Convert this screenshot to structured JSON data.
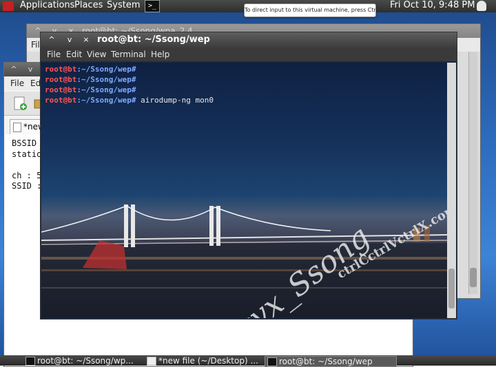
{
  "top_panel": {
    "menus": [
      "Applications",
      "Places",
      "System"
    ],
    "launcher_glyph": ">_",
    "clock": "Fri Oct 10,  9:48 PM",
    "tooltip": "To direct input to this virtual machine, press Ctrl+G."
  },
  "back_window": {
    "title": "root@bt: ~/Ssong/wpa_2.4",
    "menu_first": "File"
  },
  "editor_window": {
    "menus": [
      "File",
      "Ed"
    ],
    "tab_label": "*new",
    "lines": [
      "BSSID",
      "statio",
      "",
      "ch : 5",
      "SSID :"
    ]
  },
  "terminal": {
    "title": "root@bt: ~/Ssong/wep",
    "menus": [
      "File",
      "Edit",
      "View",
      "Terminal",
      "Help"
    ],
    "lines": [
      {
        "user": "root@bt",
        "path": ":~/Ssong/wep#",
        "cmd": ""
      },
      {
        "user": "root@bt",
        "path": ":~/Ssong/wep#",
        "cmd": ""
      },
      {
        "user": "root@bt",
        "path": ":~/Ssong/wep#",
        "cmd": ""
      },
      {
        "user": "root@bt",
        "path": ":~/Ssong/wep#",
        "cmd": " airodump-ng mon0"
      }
    ],
    "watermark_1": "cvx_Ssong",
    "watermark_2": "ctrlCctrlVctrlX.com"
  },
  "taskbar": {
    "tasks": [
      {
        "label": "root@bt: ~/Ssong/wp...",
        "active": false
      },
      {
        "label": "*new file (~/Desktop) ...",
        "active": false
      },
      {
        "label": "root@bt: ~/Ssong/wep",
        "active": true
      }
    ]
  },
  "colors": {
    "prompt_user": "#ff5555",
    "prompt_path": "#7fa9ff"
  }
}
